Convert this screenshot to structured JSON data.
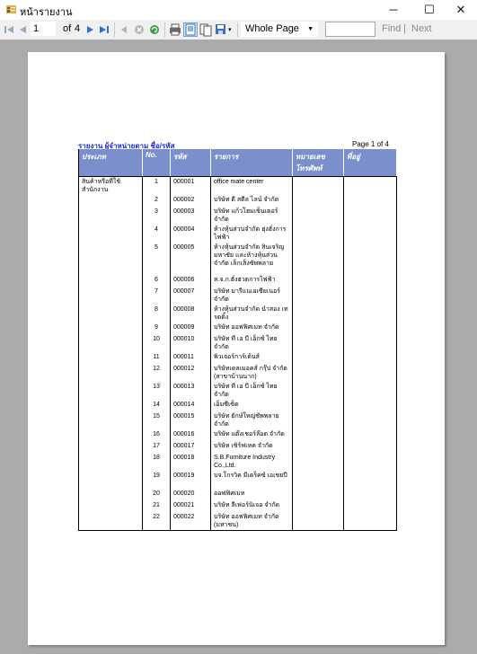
{
  "window": {
    "title": "หน้ารายงาน",
    "minimize": "─",
    "maximize": "☐",
    "close": "✕"
  },
  "toolbar": {
    "current_page": "1",
    "of_label": "of",
    "total_pages": "4",
    "zoom": "Whole Page",
    "find_label": "Find",
    "separator": "|",
    "next_label": "Next"
  },
  "report": {
    "title": "รายงาน ผู้จำหน่ายตาม ชื่อ/รหัส",
    "page_label": "Page 1 of 4",
    "columns": [
      "ประเภท",
      "No.",
      "รหัส",
      "รายการ",
      "หมายเลขโทรศัพท์",
      "ที่อยู่"
    ],
    "category": "สินค้าหรือที่ใช้สำนักงาน",
    "rows": [
      {
        "no": "1",
        "code": "000001",
        "name": "office mate center"
      },
      {
        "no": "2",
        "code": "000002",
        "name": "บริษัท ดี สตีล ไลน์ จำกัด"
      },
      {
        "no": "3",
        "code": "000003",
        "name": "บริษัท แก้วโฮมเซ็นเตอร์ จำกัด"
      },
      {
        "no": "4",
        "code": "000004",
        "name": "ห้างหุ้นส่วนจำกัด ฮุ่งฮั่งการไฟฟ้า"
      },
      {
        "no": "5",
        "code": "000005",
        "name": "ห้างหุ้นส่วนจำกัด สินเจริญมหาชัย และห้างหุ้นส่วนจำกัด เล็กเส็งซัพพลาย"
      },
      {
        "no": "6",
        "code": "000006",
        "name": "ห.จ.ก.ฮั่งฮวดการไฟฟ้า"
      },
      {
        "no": "7",
        "code": "000007",
        "name": "บริษัท มารีแนเอเซียเนอร์ จำกัด"
      },
      {
        "no": "8",
        "code": "000008",
        "name": "ห้างหุ้นส่วนจำกัด นำสอง เทรดดิ้ง"
      },
      {
        "no": "9",
        "code": "000009",
        "name": "บริษัท ออฟฟิศเมท จำกัด"
      },
      {
        "no": "10",
        "code": "000010",
        "name": "บริษัท ที เอ บี เอ็กซ์ ไทย จำกัด"
      },
      {
        "no": "11",
        "code": "000011",
        "name": "พิวเจอร์การ์เด้นส์"
      },
      {
        "no": "12",
        "code": "000012",
        "name": "บริษัทเดลเมอคส์ กรุ๊ป จำกัด (สาขาบ้านนาก)"
      },
      {
        "no": "13",
        "code": "000013",
        "name": "บริษัท ที เอ บี เอ็กซ์ ไทย จำกัด"
      },
      {
        "no": "14",
        "code": "000014",
        "name": "เอ็มซีเซ็ต"
      },
      {
        "no": "15",
        "code": "000015",
        "name": "บริษัท ยักษ์ใหญ่ซัพพลาย จำกัด"
      },
      {
        "no": "16",
        "code": "000016",
        "name": "บริษัท แต๊งเชอร์ล๊อต จำกัด"
      },
      {
        "no": "17",
        "code": "000017",
        "name": "บริษัท เชิร์ฟเทค จำกัด"
      },
      {
        "no": "18",
        "code": "000018",
        "name": "S.B.Furniture Industry Co.,Ltd."
      },
      {
        "no": "19",
        "code": "000019",
        "name": "บจ.โกรวิค มีเดร็คซ์ เอเชยปี"
      },
      {
        "no": "20",
        "code": "000020",
        "name": "ออฟฟิศเมท"
      },
      {
        "no": "21",
        "code": "000021",
        "name": "บริษัท ลีเฟอร์นิเจอ จำกัด"
      },
      {
        "no": "22",
        "code": "000022",
        "name": "บริษัท ออฟฟิศเมท จำกัด (มหาชน)"
      }
    ]
  },
  "colors": {
    "header_bg": "#7a8fcc",
    "title_color": "#1c2bd8",
    "viewer_bg": "#ababab"
  }
}
